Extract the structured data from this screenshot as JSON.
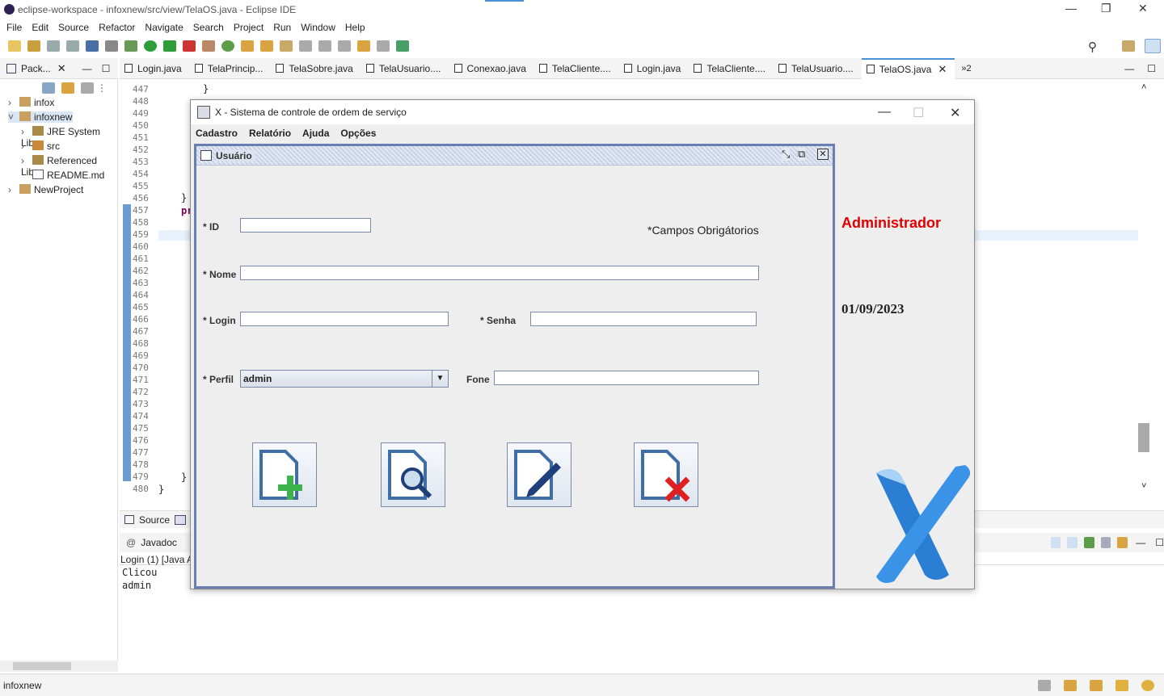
{
  "window": {
    "title": "eclipse-workspace - infoxnew/src/view/TelaOS.java - Eclipse IDE"
  },
  "menu": [
    "File",
    "Edit",
    "Source",
    "Refactor",
    "Navigate",
    "Search",
    "Project",
    "Run",
    "Window",
    "Help"
  ],
  "package_explorer": {
    "tab_label": "Pack...",
    "items": [
      "infox",
      "infoxnew",
      "JRE System Libra",
      "src",
      "Referenced Libra",
      "README.md",
      "NewProject"
    ]
  },
  "editor_tabs": [
    "Login.java",
    "TelaPrincip...",
    "TelaSobre.java",
    "TelaUsuario....",
    "Conexao.java",
    "TelaCliente....",
    "Login.java",
    "TelaCliente....",
    "TelaUsuario....",
    "TelaOS.java"
  ],
  "editor_tabs_overflow": "»2",
  "line_numbers": [
    "447",
    "448",
    "449",
    "450",
    "451",
    "452",
    "453",
    "454",
    "455",
    "456",
    "457",
    "458",
    "459",
    "460",
    "461",
    "462",
    "463",
    "464",
    "465",
    "466",
    "467",
    "468",
    "469",
    "470",
    "471",
    "472",
    "473",
    "474",
    "475",
    "476",
    "477",
    "478",
    "479",
    "480"
  ],
  "code": {
    "brace1": "}",
    "brace2": "}",
    "pr": "pr",
    "brace3": "}",
    "brace4": "}"
  },
  "bottom_tabs": {
    "source": "Source"
  },
  "console": {
    "tab": "Javadoc",
    "header": "Login (1) [Java A",
    "lines": [
      "Clicou",
      "admin"
    ]
  },
  "statusbar": {
    "text": "infoxnew"
  },
  "app": {
    "title": "X - Sistema de controle de ordem de serviço",
    "menu": [
      "Cadastro",
      "Relatório",
      "Ajuda",
      "Opções"
    ],
    "internal_frame_title": "Usuário",
    "form": {
      "id_label": "* ID",
      "required_note": "*Campos Obrigátorios",
      "nome_label": "* Nome",
      "login_label": "* Login",
      "senha_label": "* Senha",
      "perfil_label": "* Perfil",
      "perfil_value": "admin",
      "fone_label": "Fone"
    },
    "user_role": "Administrador",
    "date": "01/09/2023",
    "role_color": "#e00000"
  }
}
